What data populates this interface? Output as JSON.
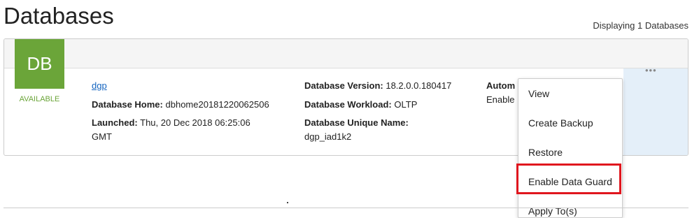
{
  "page": {
    "title": "Databases",
    "display_count": "Displaying 1 Databases"
  },
  "database": {
    "icon_text": "DB",
    "status": "AVAILABLE",
    "name": "dgp",
    "home_label": "Database Home:",
    "home_value": "dbhome20181220062506",
    "launched_label": "Launched:",
    "launched_value": "Thu, 20 Dec 2018 06:25:06",
    "launched_tz": "GMT",
    "version_label": "Database Version:",
    "version_value": "18.2.0.0.180417",
    "workload_label": "Database Workload:",
    "workload_value": "OLTP",
    "unique_name_label": "Database Unique Name:",
    "unique_name_value": "dgp_iad1k2",
    "auto_backup_label": "Autom",
    "auto_backup_value": "Enable"
  },
  "actions": {
    "kebab": "•••",
    "menu": [
      "View",
      "Create Backup",
      "Restore",
      "Enable Data Guard",
      "Apply To(s)"
    ]
  },
  "colors": {
    "available_green": "#6ba539",
    "link_blue": "#1565c0",
    "highlight_red": "#e0161e",
    "actions_bg": "#e4eff9"
  }
}
